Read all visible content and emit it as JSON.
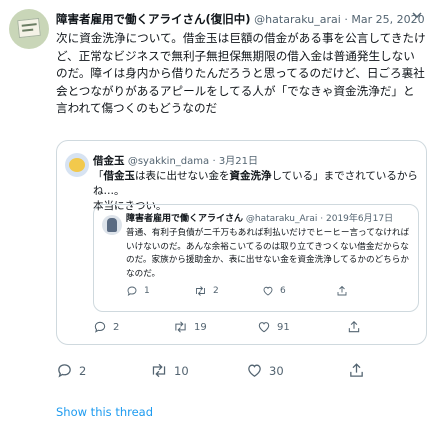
{
  "tweet": {
    "author_name": "障害者雇用で働くアライさん(復旧中)",
    "author_handle": "@hataraku_arai",
    "date": "Mar 25, 2020",
    "text": "次に資金洗浄について。借金玉は巨額の借金がある事を公言してきたけど、正常なビジネスで無利子無担保無期限の借入金は普通発生しないのだ。障イは身内から借りたんだろうと思ってるのだけど、日ごろ裏社会とつながりがあるアピールをしてる人が「でなきゃ資金洗浄だ」と言われて傷つくのもどうなのだ",
    "reply_count": "2",
    "retweet_count": "10",
    "like_count": "30"
  },
  "quote": {
    "author_name": "借金玉",
    "author_handle": "@syakkin_dama",
    "date": "3月21日",
    "text_open": "「",
    "text_bold1": "借金玉",
    "text_mid": "は表に出せない金を",
    "text_bold2": "資金洗浄",
    "text_rest": "している」までされているからね…。",
    "text_line2": "本当にきつい。",
    "reply_count": "2",
    "retweet_count": "19",
    "like_count": "91"
  },
  "inner_quote": {
    "author_name": "障害者雇用で働くアライさん",
    "author_handle": "@hataraku_Arai",
    "date": "2019年6月17日",
    "text": "普通、有利子負債が二千万もあれば利払いだけでヒーヒー言ってなければいけないのだ。あんな余裕こいてるのは取り立てきつくない借金だからなのだ。家族から援助金か、表に出せない金を資金洗浄してるかのどちらかなのだ。",
    "reply_count": "1",
    "retweet_count": "2",
    "like_count": "6"
  },
  "show_thread": "Show this thread",
  "colors": {
    "link": "#1d9bf0",
    "muted": "#536471",
    "border": "#cfd9de"
  },
  "icons": [
    "caret-down-icon",
    "reply-icon",
    "retweet-icon",
    "like-icon",
    "share-icon"
  ]
}
